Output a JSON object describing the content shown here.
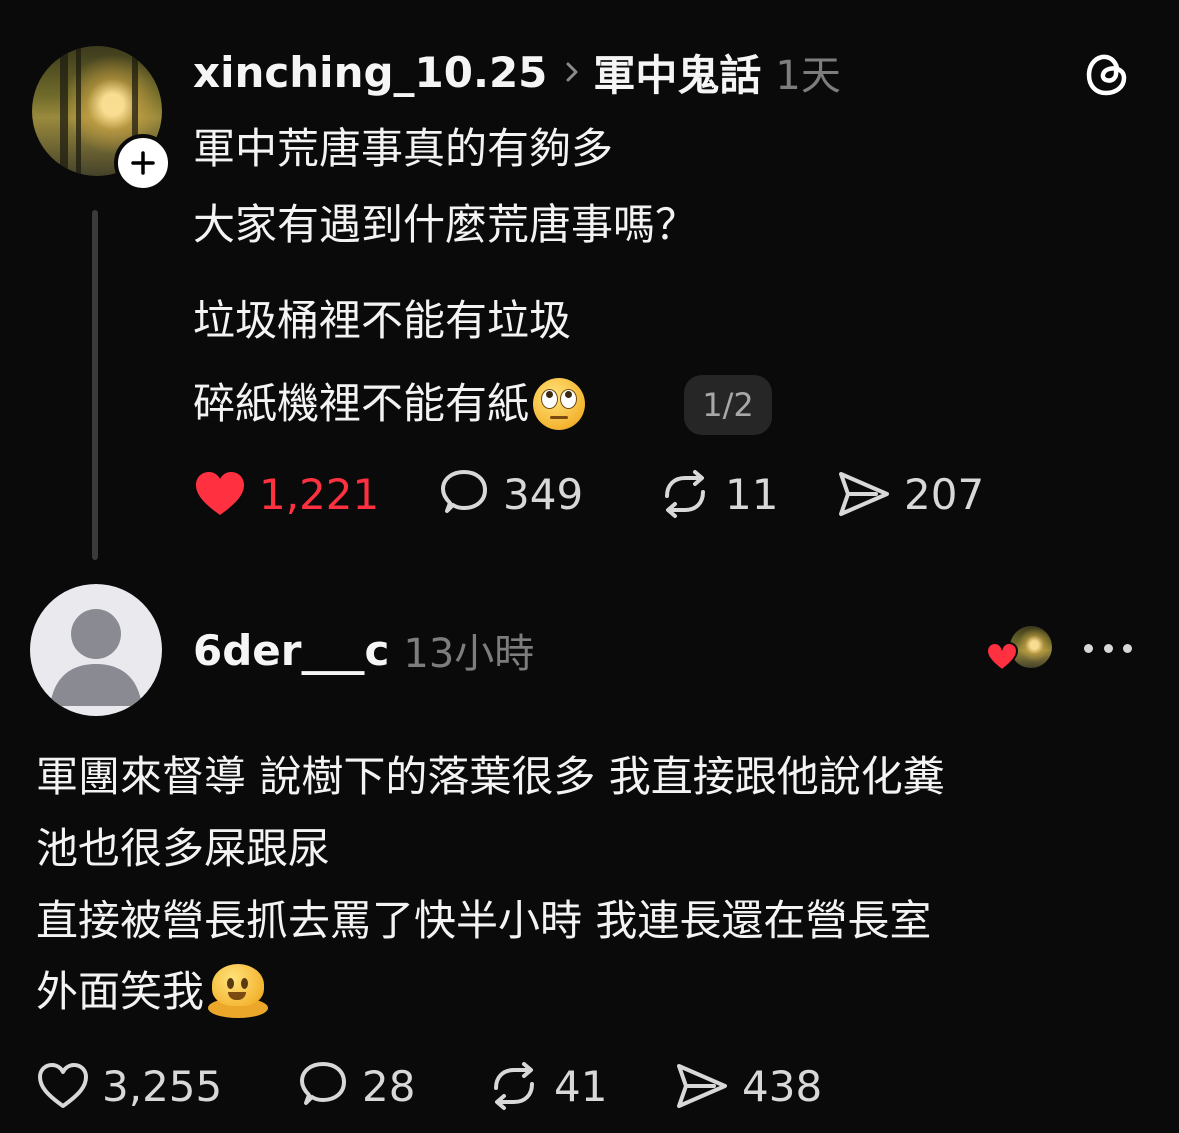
{
  "post": {
    "username": "xinching_10.25",
    "community": "軍中鬼話",
    "time": "1天",
    "body_lines": [
      "軍中荒唐事真的有夠多",
      "大家有遇到什麼荒唐事嗎？",
      "垃圾桶裡不能有垃圾",
      "碎紙機裡不能有紙"
    ],
    "emoji": "face-with-rolling-eyes",
    "pager": "1/2",
    "actions": {
      "likes": "1,221",
      "liked": true,
      "comments": "349",
      "reposts": "11",
      "shares": "207"
    }
  },
  "reply": {
    "username": "6der___c",
    "time": "13小時",
    "liked_by_author": true,
    "body_lines": [
      "軍團來督導 說樹下的落葉很多 我直接跟他說化糞",
      "池也很多屎跟尿",
      "直接被營長抓去罵了快半小時 我連長還在營長室",
      "外面笑我"
    ],
    "emoji": "melting-face",
    "actions": {
      "likes": "3,255",
      "liked": false,
      "comments": "28",
      "reposts": "41",
      "shares": "438"
    }
  },
  "colors": {
    "background": "#0a0a0a",
    "like_red": "#ff3040",
    "muted": "#7d7d7d",
    "text": "#f3f3f3"
  }
}
